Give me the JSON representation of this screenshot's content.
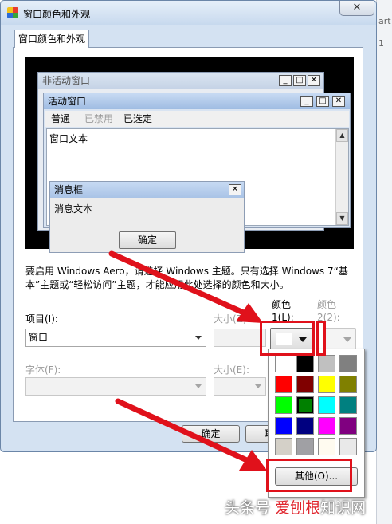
{
  "window": {
    "title": "窗口颜色和外观",
    "close_glyph": "✕"
  },
  "tab": {
    "label": "窗口颜色和外观"
  },
  "preview": {
    "inactive_title": "非活动窗口",
    "active_title": "活动窗口",
    "menu": [
      "普通",
      "已禁用",
      "已选定"
    ],
    "window_text": "窗口文本",
    "msgbox_title": "消息框",
    "msgbox_text": "消息文本",
    "msgbox_ok": "确定"
  },
  "info_text": "要启用 Windows Aero，请选择 Windows 主题。只有选择 Windows 7“基本”主题或“轻松访问”主题，才能应用此处选择的颜色和大小。",
  "item_label": "项目(I):",
  "item_value": "窗口",
  "size_label_1": "大小(Z):",
  "color1_label": "颜色 1(L):",
  "color2_label": "颜色 2(2):",
  "font_label": "字体(F):",
  "size_label_2": "大小(E):",
  "buttons": {
    "ok": "确定",
    "cancel": "取消"
  },
  "palette": {
    "other_button": "其他(O)...",
    "colors": [
      "#ffffff",
      "#000000",
      "#c0c0c0",
      "#808080",
      "#ff0000",
      "#800000",
      "#ffff00",
      "#808000",
      "#00ff00",
      "#008000",
      "#00ffff",
      "#008080",
      "#0000ff",
      "#000080",
      "#ff00ff",
      "#800080",
      "#d4d0c8",
      "#a0a0a4",
      "#fffbf0",
      "#e9e9e9"
    ],
    "selected_color": "#008000"
  },
  "side_strip": [
    "art",
    "1"
  ],
  "watermark": {
    "part1": "头条号",
    "part2": "爱刨根",
    "part3": "知识网"
  },
  "highlight_color": "#e0111b"
}
